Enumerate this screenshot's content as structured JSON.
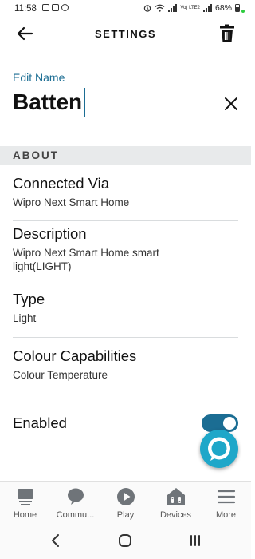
{
  "status_bar": {
    "time": "11:58",
    "battery_percent": "68%",
    "volte_label": "Vo) LTE2"
  },
  "header": {
    "title": "SETTINGS"
  },
  "edit_name": {
    "label": "Edit Name",
    "value": "Batten"
  },
  "about": {
    "section_title": "ABOUT",
    "rows": [
      {
        "title": "Connected Via",
        "value": "Wipro Next Smart Home"
      },
      {
        "title": "Description",
        "value": "Wipro Next Smart Home smart light(LIGHT)"
      },
      {
        "title": "Type",
        "value": "Light"
      },
      {
        "title": "Colour Capabilities",
        "value": "Colour Temperature"
      }
    ]
  },
  "enabled": {
    "label": "Enabled",
    "state": true
  },
  "bottom_nav": {
    "items": [
      {
        "label": "Home",
        "icon": "home-icon"
      },
      {
        "label": "Commu...",
        "icon": "communicate-icon"
      },
      {
        "label": "Play",
        "icon": "play-icon"
      },
      {
        "label": "Devices",
        "icon": "devices-icon"
      },
      {
        "label": "More",
        "icon": "more-icon"
      }
    ]
  },
  "colors": {
    "accent": "#1b6d93",
    "alexa_blue": "#1ea7c9",
    "section_bg": "#e8eaeb",
    "divider": "#d9dcde"
  }
}
